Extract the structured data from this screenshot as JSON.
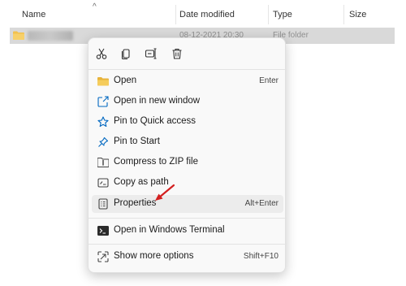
{
  "header": {
    "sort_caret": "^",
    "columns": [
      "Name",
      "Date modified",
      "Type",
      "Size"
    ]
  },
  "file_row": {
    "name": "Technical",
    "date": "08-12-2021 20:30",
    "type": "File folder"
  },
  "context_menu": {
    "quick_actions": [
      "scissors-icon",
      "copy-icon",
      "rename-icon",
      "trash-icon"
    ],
    "items": [
      {
        "label": "Open",
        "shortcut": "Enter",
        "icon": "folder-icon"
      },
      {
        "label": "Open in new window",
        "shortcut": "",
        "icon": "new-window-icon"
      },
      {
        "label": "Pin to Quick access",
        "shortcut": "",
        "icon": "star-icon"
      },
      {
        "label": "Pin to Start",
        "shortcut": "",
        "icon": "pin-icon"
      },
      {
        "label": "Compress to ZIP file",
        "shortcut": "",
        "icon": "zip-icon"
      },
      {
        "label": "Copy as path",
        "shortcut": "",
        "icon": "copy-path-icon"
      },
      {
        "label": "Properties",
        "shortcut": "Alt+Enter",
        "icon": "properties-icon"
      },
      {
        "label": "Open in Windows Terminal",
        "shortcut": "",
        "icon": "terminal-icon"
      },
      {
        "label": "Show more options",
        "shortcut": "Shift+F10",
        "icon": "more-options-icon"
      }
    ]
  },
  "colors": {
    "accent": "#0067c0",
    "folder": "#f2c14e",
    "annotation_arrow": "#d32020"
  }
}
